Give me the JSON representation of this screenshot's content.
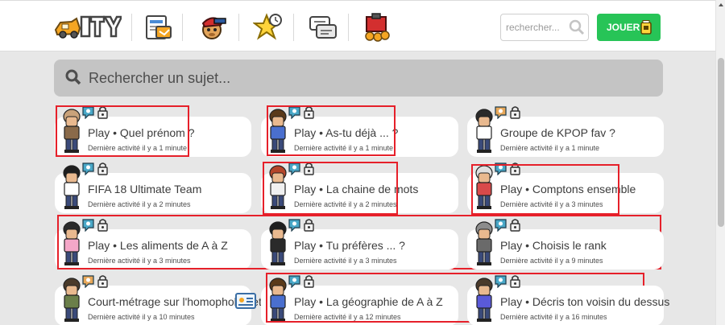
{
  "header": {
    "logo_alt": "CITY logo",
    "nav_icons": [
      "news-icon",
      "pet-icon",
      "star-icon",
      "chat-icon",
      "shop-icon"
    ],
    "search_placeholder": "rechercher...",
    "play_label": "JOUER"
  },
  "topic_search": {
    "placeholder": "Rechercher un sujet..."
  },
  "cards": [
    {
      "title": "Play • Quel prénom ?",
      "subtitle": "Dernière activité il y a 1 minute",
      "icon_1": "message-bubble-icon",
      "icon_2": "lock-icon",
      "highlighted": true
    },
    {
      "title": "Play • As-tu déjà ... ?",
      "subtitle": "Dernière activité il y a 1 minute",
      "icon_1": "message-bubble-icon",
      "icon_2": "lock-icon",
      "highlighted": true
    },
    {
      "title": "Groupe de KPOP fav ?",
      "subtitle": "Dernière activité il y a 1 minute",
      "icon_1": "message-bubble-icon",
      "icon_2": "lock-icon",
      "highlighted": false
    },
    {
      "title": "FIFA 18 Ultimate Team",
      "subtitle": "Dernière activité il y a 2 minutes",
      "icon_1": "message-bubble-icon",
      "icon_2": "lock-icon",
      "highlighted": false
    },
    {
      "title": "Play • La chaine de mots",
      "subtitle": "Dernière activité il y a 2 minutes",
      "icon_1": "message-bubble-icon",
      "icon_2": "lock-icon",
      "highlighted": true
    },
    {
      "title": "Play • Comptons ensemble",
      "subtitle": "Dernière activité il y a 3 minutes",
      "icon_1": "message-bubble-icon",
      "icon_2": "lock-icon",
      "highlighted": true
    },
    {
      "title": "Play • Les aliments de A à Z",
      "subtitle": "Dernière activité il y a 3 minutes",
      "icon_1": "message-bubble-icon",
      "icon_2": "lock-icon",
      "highlighted": true
    },
    {
      "title": "Play • Tu préfères ... ?",
      "subtitle": "Dernière activité il y a 3 minutes",
      "icon_1": "message-bubble-icon",
      "icon_2": "lock-icon",
      "highlighted": true
    },
    {
      "title": "Play • Choisis le rank",
      "subtitle": "Dernière activité il y a 9 minutes",
      "icon_1": "message-bubble-icon",
      "icon_2": "lock-icon",
      "highlighted": true
    },
    {
      "title": "Court-métrage sur l'homophobie et",
      "subtitle": "Dernière activité il y a 10 minutes",
      "icon_1": "message-bubble-icon",
      "icon_2": "lock-icon",
      "highlighted": false
    },
    {
      "title": "Play • La géographie de A à Z",
      "subtitle": "Dernière activité il y a 12 minutes",
      "icon_1": "message-bubble-icon",
      "icon_2": "lock-icon",
      "highlighted": true
    },
    {
      "title": "Play • Décris ton voisin du dessus",
      "subtitle": "Dernière activité il y a 16 minutes",
      "icon_1": "message-bubble-icon",
      "icon_2": "lock-icon",
      "highlighted": true
    }
  ],
  "colors": {
    "accent_green": "#27c457",
    "highlight_red": "#e6202a",
    "bubble_blue": "#4aa8c8",
    "bubble_orange": "#e8a85a",
    "page_bg": "#e7e7e7"
  }
}
